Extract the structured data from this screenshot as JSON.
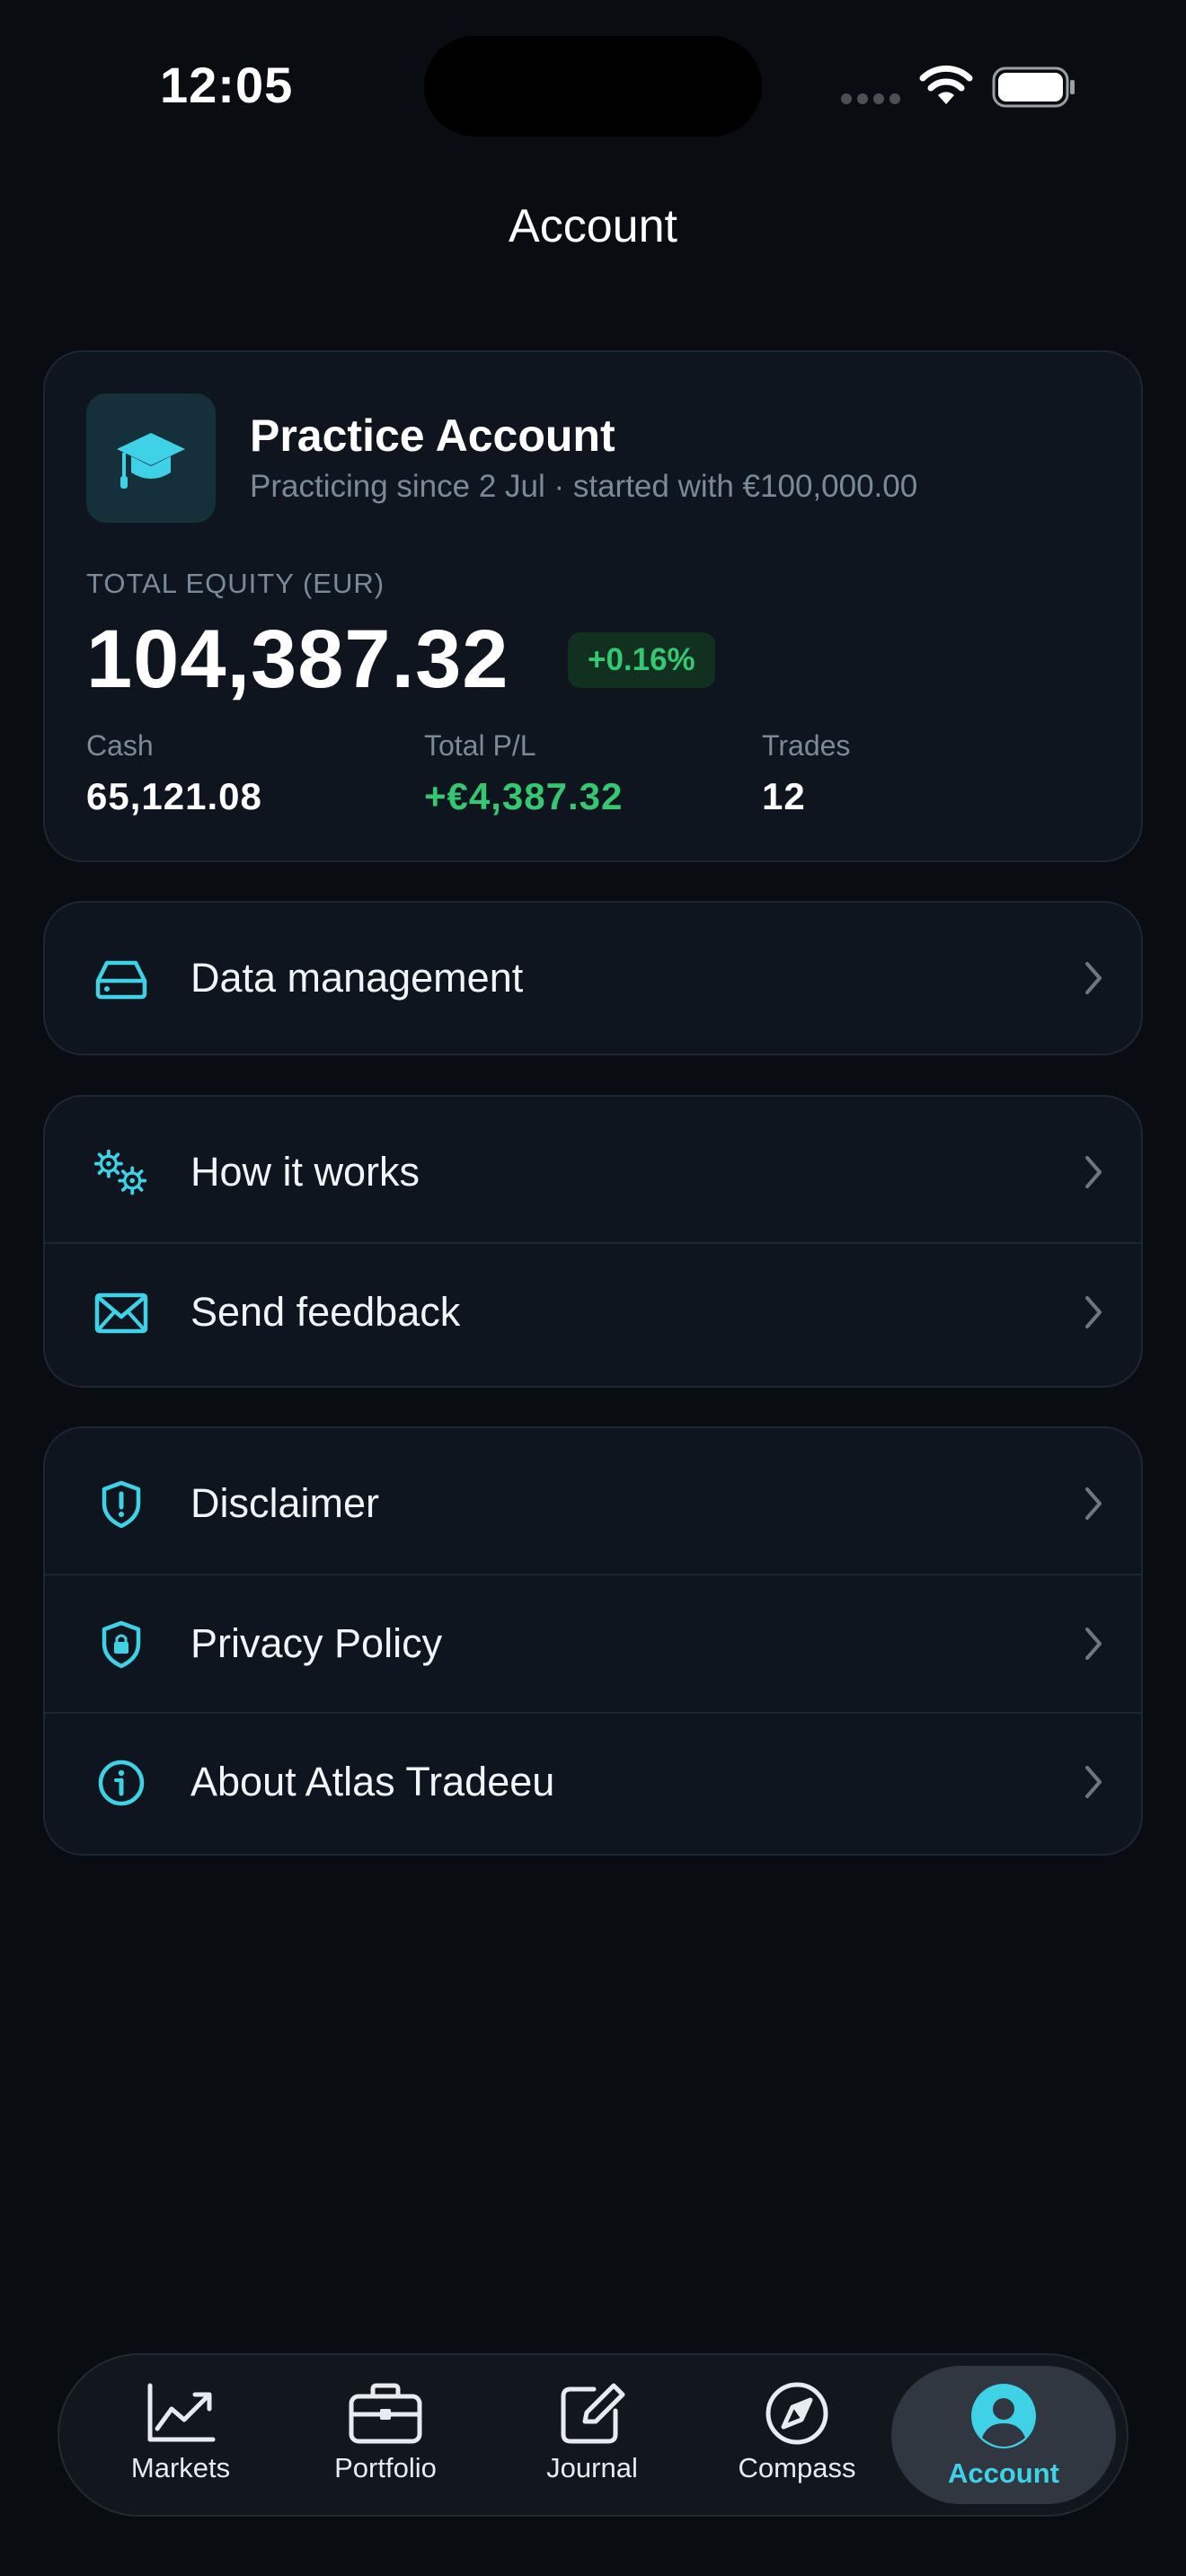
{
  "status_bar": {
    "time": "12:05"
  },
  "header": {
    "title": "Account"
  },
  "account": {
    "name": "Practice Account",
    "subtitle": "Practicing since 2 Jul · started with €100,000.00",
    "equity_label": "TOTAL EQUITY (EUR)",
    "equity_value": "104,387.32",
    "equity_change": "+0.16%",
    "stats": [
      {
        "label": "Cash",
        "value": "65,121.08"
      },
      {
        "label": "Total P/L",
        "value": "+€4,387.32"
      },
      {
        "label": "Trades",
        "value": "12"
      }
    ]
  },
  "menu": {
    "data_management": {
      "label": "Data management",
      "icon": "drive-icon"
    },
    "how_it_works": {
      "label": "How it works",
      "icon": "gears-icon"
    },
    "send_feedback": {
      "label": "Send feedback",
      "icon": "envelope-icon"
    },
    "disclaimer": {
      "label": "Disclaimer",
      "icon": "shield-exclamation-icon"
    },
    "privacy_policy": {
      "label": "Privacy Policy",
      "icon": "shield-lock-icon"
    },
    "about": {
      "label": "About Atlas Tradeeu",
      "icon": "info-icon"
    }
  },
  "tabs": [
    {
      "label": "Markets",
      "icon": "chart-icon"
    },
    {
      "label": "Portfolio",
      "icon": "briefcase-icon"
    },
    {
      "label": "Journal",
      "icon": "edit-icon"
    },
    {
      "label": "Compass",
      "icon": "compass-icon"
    },
    {
      "label": "Account",
      "icon": "person-icon",
      "active": true
    }
  ],
  "colors": {
    "accent": "#3fd2e6",
    "positive": "#35c873",
    "background": "#090c11",
    "card": "#0e151e"
  }
}
